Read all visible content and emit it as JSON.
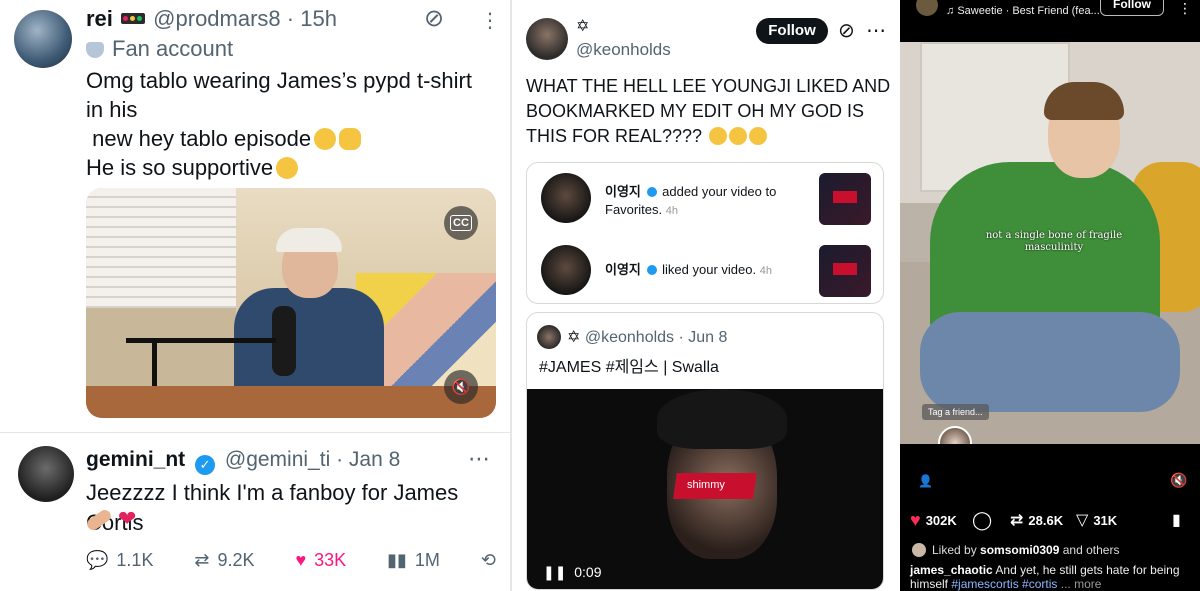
{
  "panel1": {
    "tweet1": {
      "name": "rei",
      "handle": "@prodmars8",
      "time": "15h",
      "subtitle": "Fan account",
      "lines": [
        "Omg tablo wearing James’s pypd t-shirt",
        "in his",
        " new hey tablo episode",
        "He is so supportive"
      ]
    },
    "tweet2": {
      "name": "gemini_nt",
      "handle": "@gemini_ti",
      "date": "Jan 8",
      "text": "Jeezzzz I think I'm a fanboy for James Cortis",
      "replies": "1.1K",
      "retweets": "9.2K",
      "likes": "33K",
      "views": "1M"
    }
  },
  "panel2": {
    "handle": "@keonholds",
    "follow_label": "Follow",
    "lines": [
      "WHAT THE HELL LEE YOUNGJI LIKED AND",
      "BOOKMARKED MY EDIT OH MY GOD IS",
      "THIS FOR REAL????"
    ],
    "notifications": [
      {
        "name": "이영지",
        "action": "added your video to",
        "action2": "Favorites.",
        "time": "4h"
      },
      {
        "name": "이영지",
        "action": "liked your video.",
        "time": "4h"
      }
    ],
    "quote": {
      "handle": "@keonholds",
      "date": "Jun 8",
      "text": "#JAMES #제임스 | Swalla",
      "overlay": "shimmy",
      "duration": "0:09"
    }
  },
  "panel3": {
    "song": "Saweetie · Best Friend (fea...",
    "follow_label": "Follow",
    "caption_overlay": "not a single bone of fragile masculinity",
    "tag_prompt": "Tag a friend...",
    "likes": "302K",
    "reposts": "28.6K",
    "shares": "31K",
    "liked_by_prefix": "Liked by ",
    "liked_by_user": "somsomi0309",
    "liked_by_suffix": " and others",
    "caption_user": "james_chaotic",
    "caption_text": " And yet, he still gets hate for being himself",
    "caption_tags": "#jamescortis #cortis",
    "caption_more": "... more"
  },
  "colors": {
    "twitter_blue": "#1d9bf0",
    "like_pink": "#f91880",
    "ig_red": "#ff2d55"
  }
}
